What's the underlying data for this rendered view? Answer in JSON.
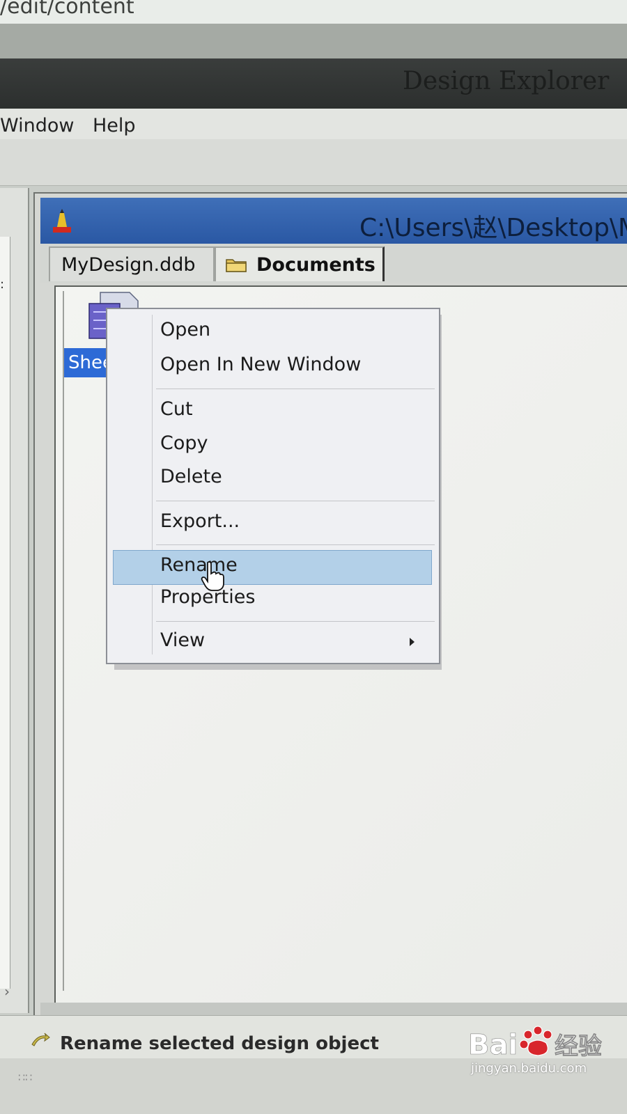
{
  "browser": {
    "url_fragment": "/edit/content"
  },
  "app": {
    "title": "Design Explorer"
  },
  "menu": {
    "items": [
      "Window",
      "Help"
    ]
  },
  "document_window": {
    "title": "C:\\Users\\赵\\Desktop\\M",
    "tabs": [
      {
        "label": "MyDesign.ddb"
      },
      {
        "label": "Documents",
        "icon": "folder-icon",
        "active": true
      }
    ]
  },
  "content": {
    "selected_item_label": "Sheet",
    "selected_item_icon": "schematic-sheet-icon"
  },
  "context_menu": {
    "items": [
      {
        "label": "Open"
      },
      {
        "label": "Open In New Window"
      },
      {
        "label": "Cut"
      },
      {
        "label": "Copy"
      },
      {
        "label": "Delete"
      },
      {
        "label": "Export..."
      },
      {
        "label": "Rename",
        "highlighted": true
      },
      {
        "label": "Properties"
      },
      {
        "label": "View",
        "has_submenu": true
      }
    ],
    "highlight_color": "#b3d0e8"
  },
  "status_bar": {
    "text": "Rename selected design object"
  },
  "watermark": {
    "brand": "Bai 经验",
    "url": "jingyan.baidu.com"
  },
  "colors": {
    "titlebar": "#2a58a4",
    "selection": "#2d6ad6"
  }
}
